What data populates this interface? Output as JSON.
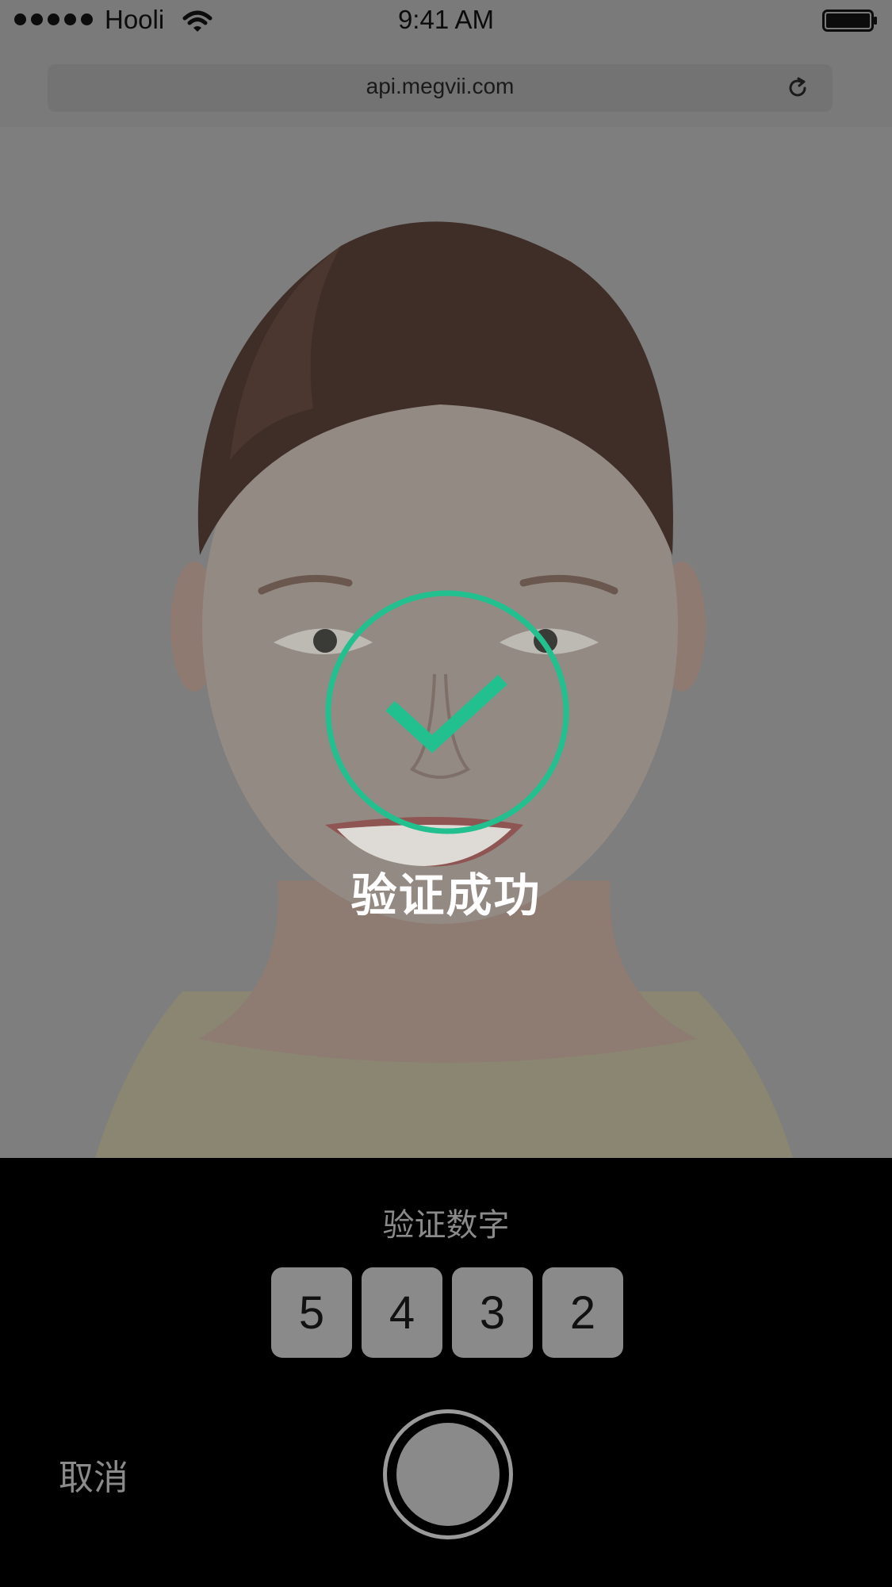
{
  "status_bar": {
    "carrier": "Hooli",
    "time": "9:41 AM",
    "signal_icon": "signal-dots-icon",
    "wifi_icon": "wifi-icon",
    "battery_icon": "battery-icon"
  },
  "browser": {
    "url": "api.megvii.com",
    "reload_icon": "reload-icon"
  },
  "result": {
    "icon": "success-check-icon",
    "message": "验证成功",
    "accent_color": "#22c08f"
  },
  "panel": {
    "verify_label": "验证数字",
    "digits": [
      "5",
      "4",
      "3",
      "2"
    ],
    "cancel_label": "取消",
    "shutter_icon": "shutter-button-icon"
  }
}
